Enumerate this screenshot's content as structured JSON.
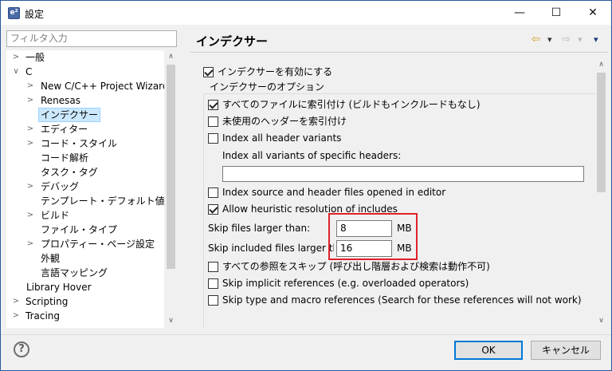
{
  "window": {
    "title": "設定",
    "minimize": "—",
    "maximize": "☐",
    "close": "✕"
  },
  "filter": {
    "placeholder": "フィルタ入力"
  },
  "tree": {
    "items": [
      {
        "label": "一般",
        "arrow": ">"
      },
      {
        "label": "C",
        "arrow": "∨"
      },
      {
        "label": "New C/C++ Project Wizard",
        "arrow": ">"
      },
      {
        "label": "Renesas",
        "arrow": ">"
      },
      {
        "label": "インデクサー",
        "arrow": ""
      },
      {
        "label": "エディター",
        "arrow": ">"
      },
      {
        "label": "コード・スタイル",
        "arrow": ">"
      },
      {
        "label": "コード解析",
        "arrow": ""
      },
      {
        "label": "タスク・タグ",
        "arrow": ""
      },
      {
        "label": "デバッグ",
        "arrow": ">"
      },
      {
        "label": "テンプレート・デフォルト値",
        "arrow": ""
      },
      {
        "label": "ビルド",
        "arrow": ">"
      },
      {
        "label": "ファイル・タイプ",
        "arrow": ""
      },
      {
        "label": "プロパティー・ページ設定",
        "arrow": ">"
      },
      {
        "label": "外観",
        "arrow": ""
      },
      {
        "label": "言語マッピング",
        "arrow": ""
      },
      {
        "label": "Library Hover",
        "arrow": ""
      },
      {
        "label": "Scripting",
        "arrow": ">"
      },
      {
        "label": "Tracing",
        "arrow": ">"
      }
    ],
    "scroll_up": "∧",
    "scroll_down": "∨"
  },
  "page": {
    "title": "インデクサー",
    "nav": {
      "back": "⇦",
      "back_menu": "▾",
      "forward": "⇨",
      "forward_menu": "▾",
      "view_menu": "▾"
    }
  },
  "options": {
    "enable_indexer": {
      "label": "インデクサーを有効にする",
      "checked": true
    },
    "group_title": "インデクサーのオプション",
    "index_all_files": {
      "label": "すべてのファイルに索引付け (ビルドもインクルードもなし)",
      "checked": true
    },
    "index_unused_headers": {
      "label": "未使用のヘッダーを索引付け",
      "checked": false
    },
    "index_all_header_variants": {
      "label": "Index all header variants",
      "checked": false
    },
    "specific_headers_label": "Index all variants of specific headers:",
    "specific_headers_value": "",
    "index_open_files": {
      "label": "Index source and header files opened in editor",
      "checked": false
    },
    "heuristic_resolution": {
      "label": "Allow heuristic resolution of includes",
      "checked": true
    },
    "skip_files_label": "Skip files larger than:",
    "skip_files_value": "8",
    "skip_files_unit": "MB",
    "skip_included_label": "Skip included files larger than:",
    "skip_included_value": "16",
    "skip_included_unit": "MB",
    "skip_all_refs": {
      "label": "すべての参照をスキップ (呼び出し階層および検索は動作不可)",
      "checked": false
    },
    "skip_implicit_refs": {
      "label": "Skip implicit references (e.g. overloaded operators)",
      "checked": false
    },
    "skip_type_macro_refs": {
      "label": "Skip type and macro references (Search for these references will not work)",
      "checked": false
    }
  },
  "buttons": {
    "help": "?",
    "ok": "OK",
    "cancel": "キャンセル"
  }
}
